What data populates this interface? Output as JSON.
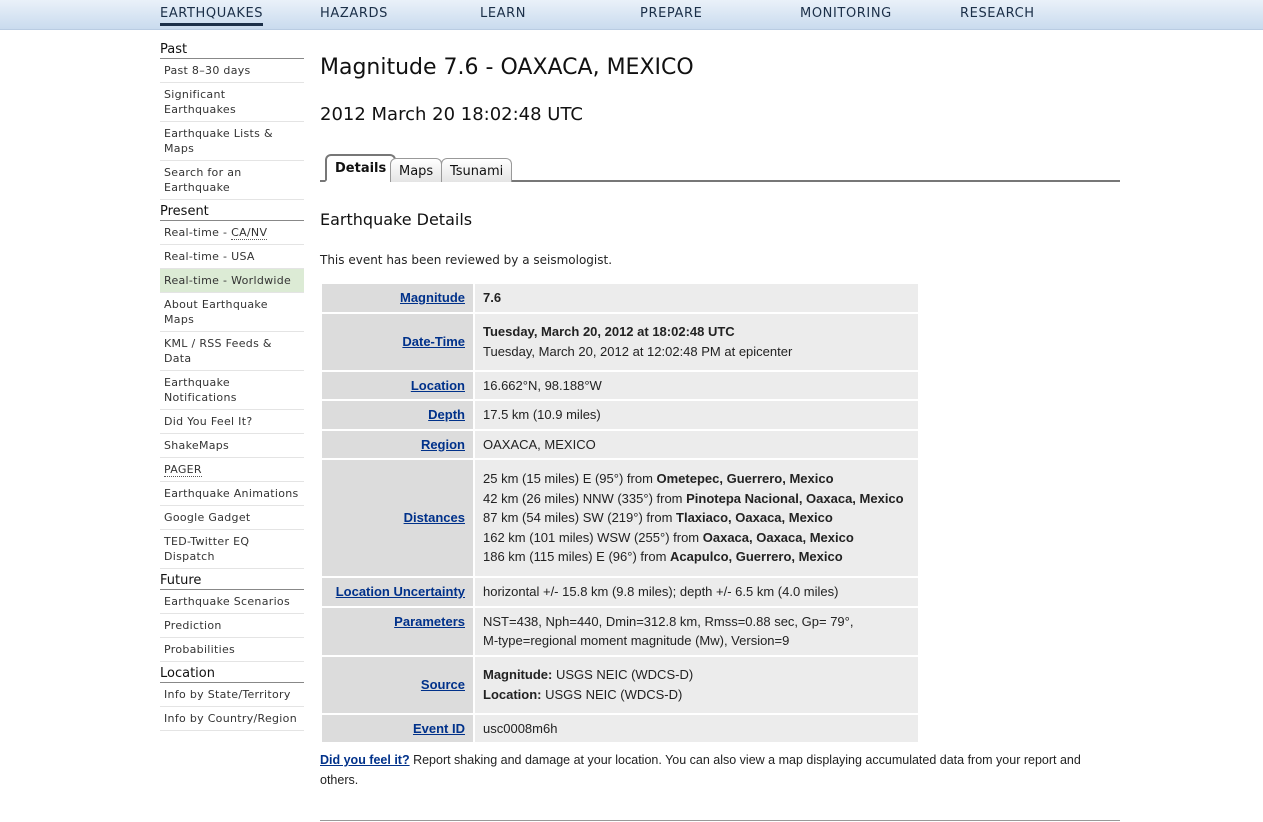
{
  "topnav": {
    "items": [
      "EARTHQUAKES",
      "HAZARDS",
      "LEARN",
      "PREPARE",
      "MONITORING",
      "RESEARCH"
    ]
  },
  "sidebar": {
    "past_heading": "Past",
    "past": [
      "Past 8–30 days",
      "Significant Earthquakes",
      "Earthquake Lists & Maps",
      "Search for an Earthquake"
    ],
    "present_heading": "Present",
    "present_ca_prefix": "Real-time - ",
    "present_ca_abbr": "CA/NV",
    "present": [
      "Real-time - USA",
      "Real-time - Worldwide",
      "About Earthquake Maps",
      "KML / RSS Feeds & Data",
      "Earthquake Notifications",
      "Did You Feel It?",
      "ShakeMaps",
      "PAGER",
      "Earthquake Animations",
      "Google Gadget",
      "TED-Twitter EQ Dispatch"
    ],
    "future_heading": "Future",
    "future": [
      "Earthquake Scenarios",
      "Prediction",
      "Probabilities"
    ],
    "location_heading": "Location",
    "location": [
      "Info by State/Territory",
      "Info by Country/Region"
    ]
  },
  "main": {
    "title": "Magnitude 7.6 - OAXACA, MEXICO",
    "datetime": "2012 March 20 18:02:48 UTC",
    "tabs": [
      "Details",
      "Maps",
      "Tsunami"
    ],
    "section_title": "Earthquake Details",
    "reviewed": "This event has been reviewed by a seismologist."
  },
  "details": {
    "magnitude": {
      "label": "Magnitude",
      "value": "7.6"
    },
    "datetime": {
      "label": "Date-Time",
      "utc": "Tuesday, March 20, 2012 at 18:02:48 UTC",
      "local": "Tuesday, March 20, 2012 at 12:02:48 PM at epicenter"
    },
    "location": {
      "label": "Location",
      "value": "16.662°N, 98.188°W"
    },
    "depth": {
      "label": "Depth",
      "value": "17.5 km (10.9 miles)"
    },
    "region": {
      "label": "Region",
      "value": "OAXACA, MEXICO"
    },
    "distances": {
      "label": "Distances",
      "rows": [
        {
          "pre": "25 km (15 miles) E (95°) from ",
          "place": "Ometepec, Guerrero, Mexico"
        },
        {
          "pre": "42 km (26 miles) NNW (335°) from ",
          "place": "Pinotepa Nacional, Oaxaca, Mexico"
        },
        {
          "pre": "87 km (54 miles) SW (219°) from ",
          "place": "Tlaxiaco, Oaxaca, Mexico"
        },
        {
          "pre": "162 km (101 miles) WSW (255°) from ",
          "place": "Oaxaca, Oaxaca, Mexico"
        },
        {
          "pre": "186 km (115 miles) E (96°) from ",
          "place": "Acapulco, Guerrero, Mexico"
        }
      ]
    },
    "uncertainty": {
      "label": "Location Uncertainty",
      "value": "horizontal +/- 15.8 km (9.8 miles); depth +/- 6.5 km (4.0 miles)"
    },
    "parameters": {
      "label": "Parameters",
      "line1": "NST=438, Nph=440, Dmin=312.8 km, Rmss=0.88 sec, Gp= 79°,",
      "line2": "M-type=regional moment magnitude (Mw), Version=9"
    },
    "source": {
      "label": "Source",
      "mag_label": "Magnitude:",
      "mag_value": " USGS NEIC (WDCS-D)",
      "loc_label": "Location:",
      "loc_value": " USGS NEIC (WDCS-D)"
    },
    "event_id": {
      "label": "Event ID",
      "value": "usc0008m6h"
    }
  },
  "dyfi": {
    "link": "Did you feel it?",
    "text": " Report shaking and damage at your location. You can also view a map displaying accumulated data from your report and others."
  }
}
